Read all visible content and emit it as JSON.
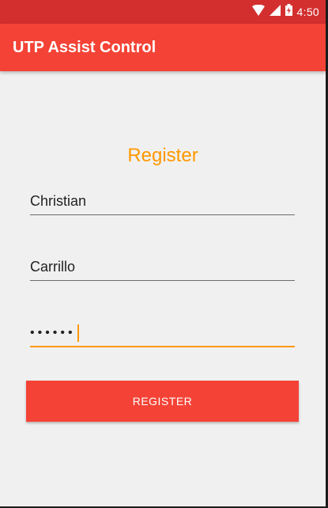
{
  "status_bar": {
    "time": "4:50",
    "icons": [
      "wifi-icon",
      "signal-icon",
      "battery-icon"
    ]
  },
  "app_bar": {
    "title": "UTP Assist Control"
  },
  "form": {
    "heading": "Register",
    "first_name": {
      "value": "Christian"
    },
    "last_name": {
      "value": "Carrillo"
    },
    "password": {
      "masked_value": "••••••"
    }
  },
  "actions": {
    "register_label": "REGISTER"
  },
  "colors": {
    "status_bar": "#d32f2f",
    "app_bar": "#f44336",
    "accent": "#ff9800",
    "background": "#f0f0f0"
  }
}
